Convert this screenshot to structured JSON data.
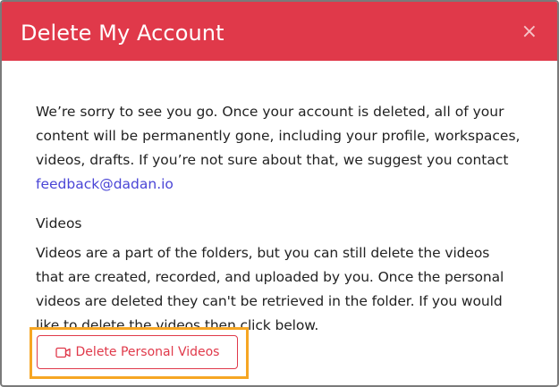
{
  "dialog": {
    "title": "Delete My Account",
    "close_glyph": "×",
    "intro_text": "We’re sorry to see you go. Once your account is deleted, all of your content will be permanently gone, including your profile, workspaces, videos, drafts. If you’re not sure about that, we suggest you contact ",
    "contact_link": "feedback@dadan.io",
    "videos_heading": "Videos",
    "videos_text": "Videos are a part of the folders, but you can still delete the videos that are created, recorded, and uploaded by you. Once the personal videos are deleted they can't be retrieved in the folder. If you would like to delete the videos then click below.",
    "delete_button_label": "Delete Personal Videos",
    "delete_button_icon": "video-camera-icon"
  },
  "colors": {
    "header_bg": "#e0394a",
    "accent": "#e0394a",
    "link": "#4a45d6",
    "highlight": "#f6a623"
  }
}
